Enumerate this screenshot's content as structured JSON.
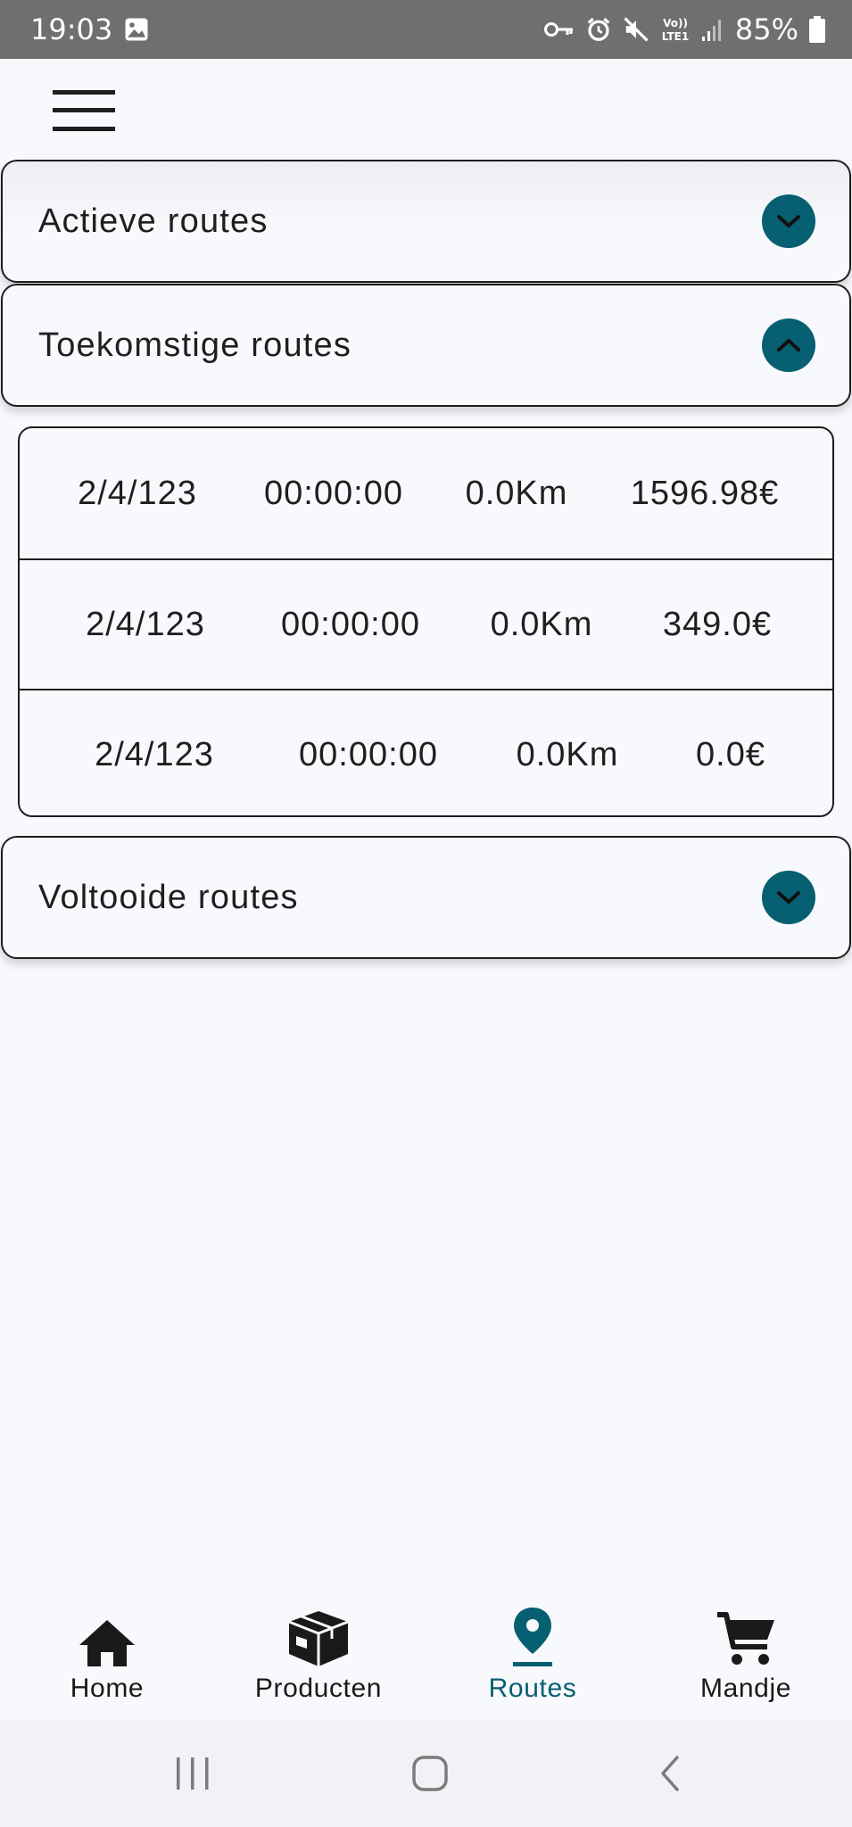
{
  "status_bar": {
    "time": "19:03",
    "battery": "85%",
    "icons": [
      "image-icon",
      "key-icon",
      "alarm-icon",
      "mute-icon",
      "volte-lte-icon",
      "signal-icon",
      "battery-icon"
    ]
  },
  "app_bar": {
    "menu_icon": "hamburger-menu-icon"
  },
  "panels": [
    {
      "title": "Actieve routes",
      "expanded": false
    },
    {
      "title": "Toekomstige routes",
      "expanded": true
    },
    {
      "title": "Voltooide routes",
      "expanded": false
    }
  ],
  "routes": [
    {
      "date": "2/4/123",
      "time": "00:00:00",
      "distance": "0.0Km",
      "price": "1596.98€"
    },
    {
      "date": "2/4/123",
      "time": "00:00:00",
      "distance": "0.0Km",
      "price": "349.0€"
    },
    {
      "date": "2/4/123",
      "time": "00:00:00",
      "distance": "0.0Km",
      "price": "0.0€"
    }
  ],
  "bottom_nav": {
    "items": [
      {
        "label": "Home",
        "icon": "home-icon",
        "active": false
      },
      {
        "label": "Producten",
        "icon": "package-icon",
        "active": false
      },
      {
        "label": "Routes",
        "icon": "location-pin-icon",
        "active": true
      },
      {
        "label": "Mandje",
        "icon": "cart-icon",
        "active": false
      }
    ]
  },
  "colors": {
    "accent": "#075f72",
    "background": "#f8f9fc",
    "status_bar": "#6f6f6f",
    "border": "#1e1e1e"
  }
}
